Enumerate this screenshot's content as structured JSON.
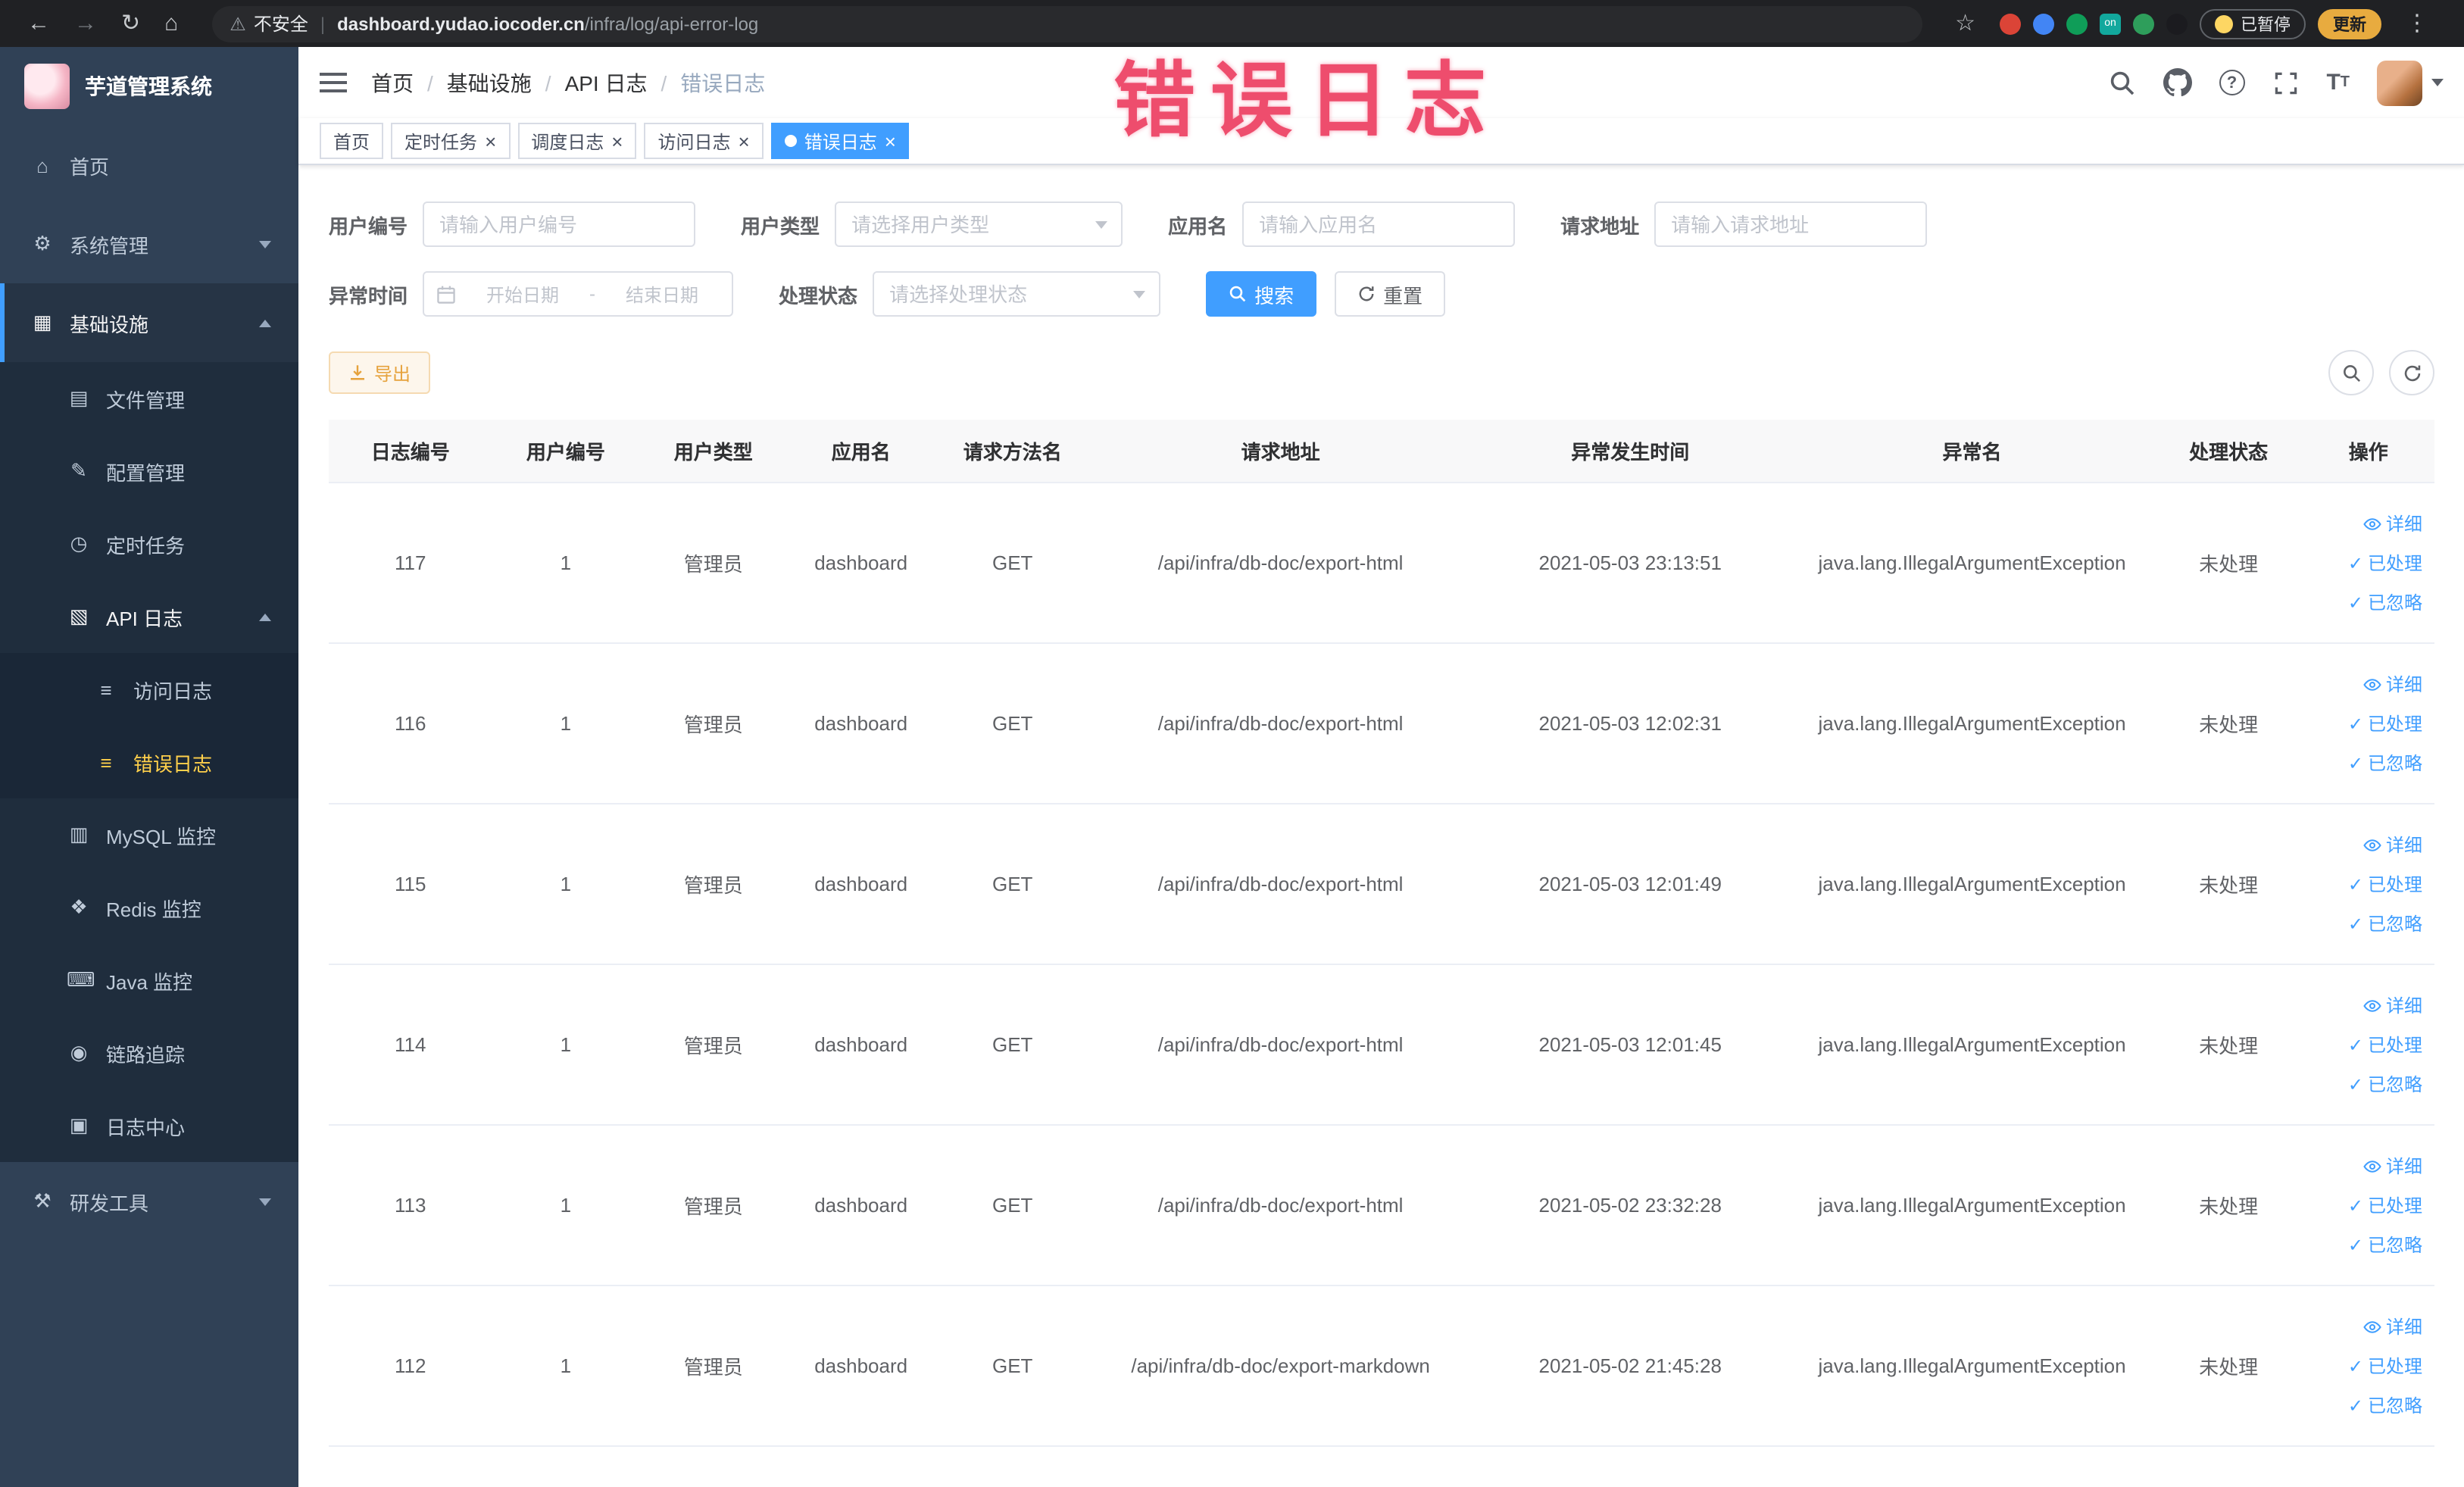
{
  "browser": {
    "warning_label": "不安全",
    "url_domain": "dashboard.yudao.iocoder.cn",
    "url_path": "/infra/log/api-error-log",
    "separator": "|",
    "ext_on_badge": "on",
    "paused_badge": "已暂停",
    "update_button": "更新"
  },
  "watermark": "错误日志",
  "sidebar": {
    "title": "芋道管理系统",
    "home": "首页",
    "system": "系统管理",
    "infra": "基础设施",
    "file": "文件管理",
    "config": "配置管理",
    "job": "定时任务",
    "apilog": "API 日志",
    "accesslog": "访问日志",
    "errorlog": "错误日志",
    "mysql": "MySQL 监控",
    "redis": "Redis 监控",
    "java": "Java 监控",
    "trace": "链路追踪",
    "logcenter": "日志中心",
    "devtool": "研发工具"
  },
  "breadcrumb": {
    "b0": "首页",
    "b1": "基础设施",
    "b2": "API 日志",
    "b3": "错误日志",
    "sep": "/"
  },
  "tabs": {
    "t0": "首页",
    "t1": "定时任务",
    "t2": "调度日志",
    "t3": "访问日志",
    "t4": "错误日志"
  },
  "filters": {
    "user_id_label": "用户编号",
    "user_id_placeholder": "请输入用户编号",
    "user_type_label": "用户类型",
    "user_type_placeholder": "请选择用户类型",
    "app_name_label": "应用名",
    "app_name_placeholder": "请输入应用名",
    "request_url_label": "请求地址",
    "request_url_placeholder": "请输入请求地址",
    "exception_time_label": "异常时间",
    "start_date_placeholder": "开始日期",
    "end_date_placeholder": "结束日期",
    "range_separator": "-",
    "process_status_label": "处理状态",
    "process_status_placeholder": "请选择处理状态",
    "search_button": "搜索",
    "reset_button": "重置"
  },
  "toolbar": {
    "export_button": "导出"
  },
  "table": {
    "columns": {
      "c0": "日志编号",
      "c1": "用户编号",
      "c2": "用户类型",
      "c3": "应用名",
      "c4": "请求方法名",
      "c5": "请求地址",
      "c6": "异常发生时间",
      "c7": "异常名",
      "c8": "处理状态",
      "c9": "操作"
    },
    "actions": {
      "detail": "详细",
      "processed": "已处理",
      "ignored": "已忽略"
    },
    "rows": [
      {
        "id": "117",
        "user_id": "1",
        "user_type": "管理员",
        "app": "dashboard",
        "method": "GET",
        "url": "/api/infra/db-doc/export-html",
        "time": "2021-05-03 23:13:51",
        "exception": "java.lang.IllegalArgumentException",
        "status": "未处理"
      },
      {
        "id": "116",
        "user_id": "1",
        "user_type": "管理员",
        "app": "dashboard",
        "method": "GET",
        "url": "/api/infra/db-doc/export-html",
        "time": "2021-05-03 12:02:31",
        "exception": "java.lang.IllegalArgumentException",
        "status": "未处理"
      },
      {
        "id": "115",
        "user_id": "1",
        "user_type": "管理员",
        "app": "dashboard",
        "method": "GET",
        "url": "/api/infra/db-doc/export-html",
        "time": "2021-05-03 12:01:49",
        "exception": "java.lang.IllegalArgumentException",
        "status": "未处理"
      },
      {
        "id": "114",
        "user_id": "1",
        "user_type": "管理员",
        "app": "dashboard",
        "method": "GET",
        "url": "/api/infra/db-doc/export-html",
        "time": "2021-05-03 12:01:45",
        "exception": "java.lang.IllegalArgumentException",
        "status": "未处理"
      },
      {
        "id": "113",
        "user_id": "1",
        "user_type": "管理员",
        "app": "dashboard",
        "method": "GET",
        "url": "/api/infra/db-doc/export-html",
        "time": "2021-05-02 23:32:28",
        "exception": "java.lang.IllegalArgumentException",
        "status": "未处理"
      },
      {
        "id": "112",
        "user_id": "1",
        "user_type": "管理员",
        "app": "dashboard",
        "method": "GET",
        "url": "/api/infra/db-doc/export-markdown",
        "time": "2021-05-02 21:45:28",
        "exception": "java.lang.IllegalArgumentException",
        "status": "未处理"
      }
    ]
  },
  "icons": {
    "back": "←",
    "forward": "→",
    "reload": "↻",
    "home": "⌂",
    "warning": "⚠",
    "star": "☆",
    "kebab": "⋮",
    "question": "?",
    "close": "×",
    "check": "✓",
    "font_large": "T",
    "font_small": "T",
    "menu_home": "⌂",
    "menu_system": "⚙",
    "menu_infra": "▦",
    "menu_file": "▤",
    "menu_config": "✎",
    "menu_job": "◷",
    "menu_apilog": "▧",
    "menu_accesslog": "≡",
    "menu_errorlog": "≡",
    "menu_mysql": "▥",
    "menu_redis": "❖",
    "menu_java": "⌨",
    "menu_trace": "◉",
    "menu_logcenter": "▣",
    "menu_devtool": "⚒"
  },
  "colors": {
    "accent": "#409eff",
    "warning": "#e6a23c",
    "sidebar_bg": "#304156",
    "sidebar_active_text": "#ffd04b",
    "watermark": "#ee4d6d",
    "tag_active_bg": "#409eff",
    "chrome_bg": "#202124"
  }
}
